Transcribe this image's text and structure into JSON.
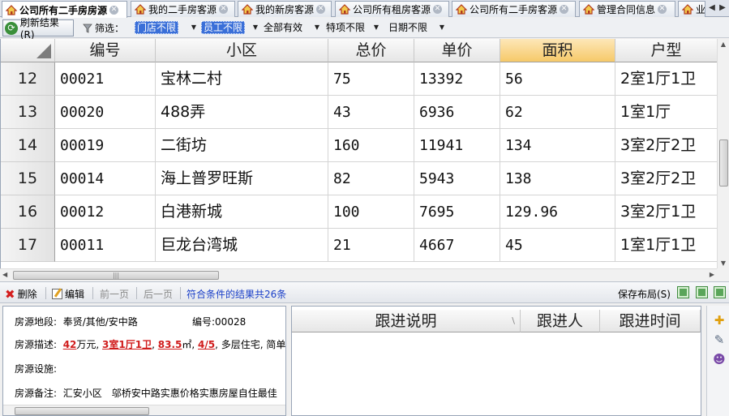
{
  "tabs": [
    {
      "label": "公司所有二手房房源",
      "active": true
    },
    {
      "label": "我的二手房客源",
      "active": false
    },
    {
      "label": "我的新房客源",
      "active": false
    },
    {
      "label": "公司所有租房客源",
      "active": false
    },
    {
      "label": "公司所有二手房客源",
      "active": false
    },
    {
      "label": "管理合同信息",
      "active": false
    },
    {
      "label": "业",
      "active": false
    }
  ],
  "filterbar": {
    "refresh_label": "刷新结果(R)",
    "filter_label": "筛选：",
    "filters": [
      {
        "value": "门店不限",
        "highlight": true
      },
      {
        "value": "员工不限",
        "highlight": true
      },
      {
        "value": "全部有效",
        "highlight": false
      },
      {
        "value": "特项不限",
        "highlight": false
      },
      {
        "value": "日期不限",
        "highlight": false
      }
    ]
  },
  "grid": {
    "columns": [
      "编号",
      "小区",
      "总价",
      "单价",
      "面积",
      "户型"
    ],
    "sorted_column": "面积",
    "rows": [
      {
        "num": "12",
        "cells": [
          "00021",
          "宝林二村",
          "75",
          "13392",
          "56",
          "2室1厅1卫"
        ]
      },
      {
        "num": "13",
        "cells": [
          "00020",
          "488弄",
          "43",
          "6936",
          "62",
          "1室1厅"
        ]
      },
      {
        "num": "14",
        "cells": [
          "00019",
          "二街坊",
          "160",
          "11941",
          "134",
          "3室2厅2卫"
        ]
      },
      {
        "num": "15",
        "cells": [
          "00014",
          "海上普罗旺斯",
          "82",
          "5943",
          "138",
          "3室2厅2卫"
        ]
      },
      {
        "num": "16",
        "cells": [
          "00012",
          "白港新城",
          "100",
          "7695",
          "129.96",
          "3室2厅1卫"
        ]
      },
      {
        "num": "17",
        "cells": [
          "00011",
          "巨龙台湾城",
          "21",
          "4667",
          "45",
          "1室1厅1卫"
        ]
      }
    ]
  },
  "actions": {
    "delete_label": "删除",
    "edit_label": "编辑",
    "prev_label": "前一页",
    "next_label": "后一页",
    "result_text": "符合条件的结果共26条",
    "save_layout_label": "保存布局(S)"
  },
  "detail": {
    "location_label": "房源地段:",
    "location_value": "奉贤/其他/安中路",
    "id_label": "编号:",
    "id_value": "00028",
    "desc_label": "房源描述:",
    "desc_price": "42",
    "desc_price_unit": "万元,",
    "desc_layout": "3室1厅1卫",
    "desc_area": "83.5",
    "desc_area_unit": "㎡,",
    "desc_floor": "4/5",
    "desc_rest": ", 多层住宅, 简单",
    "facility_label": "房源设施:",
    "remark_label": "房源备注:",
    "remark_value": "汇安小区　邬桥安中路实惠价格实惠房屋自住最佳"
  },
  "follow": {
    "columns": [
      "跟进说明",
      "跟进人",
      "跟进时间"
    ]
  },
  "colors": {
    "accent": "#3a6fd8",
    "delete": "#d41e1e",
    "result_link": "#1a3fc8",
    "sorted_header": "#f6c969"
  }
}
